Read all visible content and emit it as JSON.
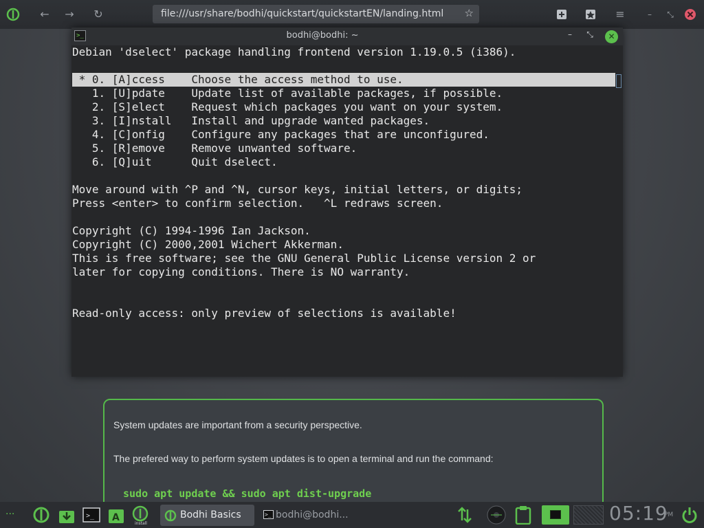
{
  "browser": {
    "url": "file:///usr/share/bodhi/quickstart/quickstartEN/landing.html",
    "back_icon": "arrow-left-icon",
    "forward_icon": "arrow-right-icon",
    "reload_icon": "reload-icon"
  },
  "terminal": {
    "title": "bodhi@bodhi: ~",
    "lines": [
      "Debian 'dselect' package handling frontend version 1.19.0.5 (i386).",
      "",
      " * 0. [A]ccess    Choose the access method to use.",
      "   1. [U]pdate    Update list of available packages, if possible.",
      "   2. [S]elect    Request which packages you want on your system.",
      "   3. [I]nstall   Install and upgrade wanted packages.",
      "   4. [C]onfig    Configure any packages that are unconfigured.",
      "   5. [R]emove    Remove unwanted software.",
      "   6. [Q]uit      Quit dselect.",
      "",
      "Move around with ^P and ^N, cursor keys, initial letters, or digits;",
      "Press <enter> to confirm selection.   ^L redraws screen.",
      "",
      "Copyright (C) 1994-1996 Ian Jackson.",
      "Copyright (C) 2000,2001 Wichert Akkerman.",
      "This is free software; see the GNU General Public License version 2 or",
      "later for copying conditions. There is NO warranty.",
      "",
      "",
      "Read-only access: only preview of selections is available!"
    ]
  },
  "info_card": {
    "p1": "System updates are important from a security perspective.",
    "p2": "The prefered way to perform system updates is to open a terminal and run the command:",
    "command": "sudo apt update && sudo apt dist-upgrade"
  },
  "taskbar": {
    "tasks": [
      {
        "label": "Bodhi Basics"
      },
      {
        "label": "bodhi@bodhi..."
      }
    ],
    "clock_time": "05:19",
    "clock_ampm": "PM",
    "install_label": "install"
  },
  "colors": {
    "accent": "#5cc04d",
    "terminal_bg": "#262729",
    "selection_bg": "#d2d2d2"
  }
}
